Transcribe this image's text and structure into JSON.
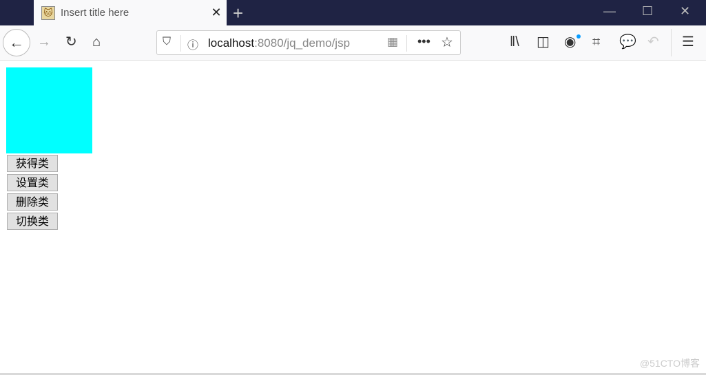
{
  "tab": {
    "title": "Insert title here",
    "favicon": "tomcat-icon"
  },
  "address": {
    "host": "localhost",
    "rest": ":8080/jq_demo/jsp"
  },
  "page": {
    "box_color": "#00ffff",
    "buttons": [
      "获得类",
      "设置类",
      "删除类",
      "切换类"
    ]
  },
  "watermark": "@51CTO博客"
}
